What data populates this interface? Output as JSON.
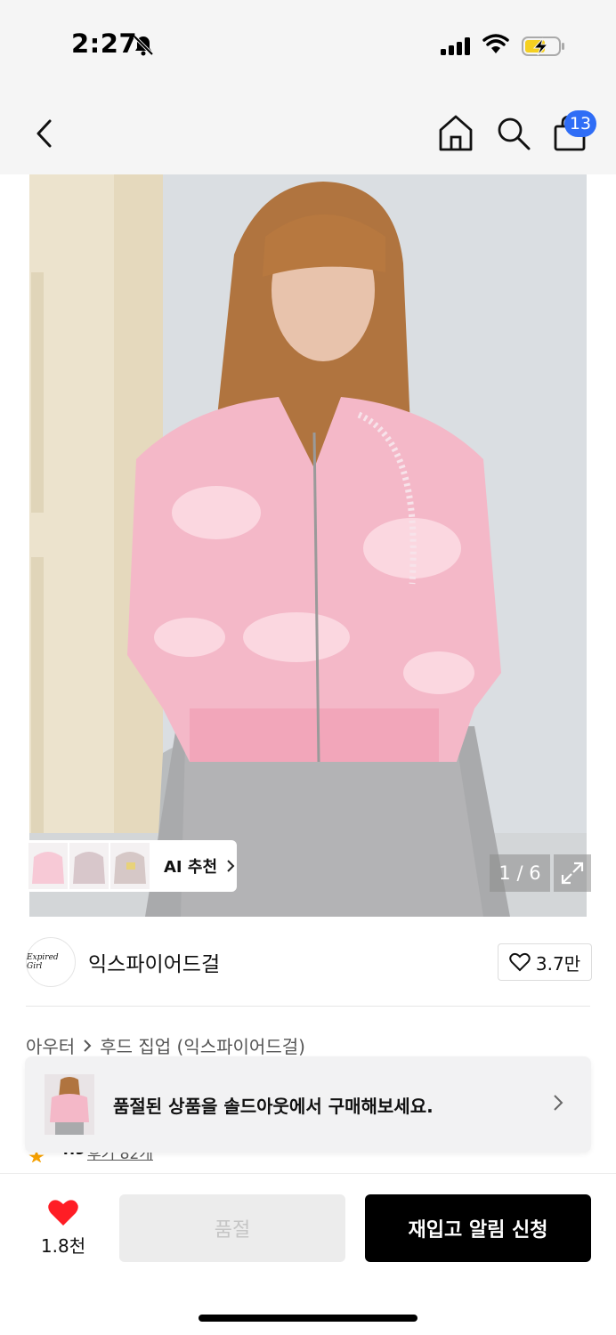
{
  "status_bar": {
    "time": "2:27",
    "bell_icon": "bell-slash-icon",
    "signal_icon": "cellular-signal-icon",
    "wifi_icon": "wifi-icon",
    "battery_icon": "battery-charging-icon"
  },
  "nav": {
    "back_icon": "chevron-left-icon",
    "home_icon": "home-icon",
    "search_icon": "search-icon",
    "cart_icon": "shopping-bag-icon",
    "cart_count": "13"
  },
  "product_image": {
    "counter": "1 / 6",
    "expand_icon": "expand-icon"
  },
  "ai_recommend": {
    "label": "AI 추천"
  },
  "brand": {
    "logo_text": "Expired Girl",
    "name": "익스파이어드걸",
    "likes": "3.7만"
  },
  "breadcrumb": {
    "items": [
      "아우터",
      "후드 집업 (익스파이어드걸)"
    ]
  },
  "rating": {
    "score": "4.9",
    "review_link": "후기 82개"
  },
  "soldout_banner": {
    "text": "품절된 상품을 솔드아웃에서 구매해보세요."
  },
  "bottom_bar": {
    "wish_count": "1.8천",
    "soldout_label": "품절",
    "restock_label": "재입고 알림 신청"
  },
  "colors": {
    "accent_blue": "#2f6df6",
    "heart_red": "#ff1d25",
    "primary_black": "#000000",
    "hoodie_pink": "#f4b8c8"
  }
}
